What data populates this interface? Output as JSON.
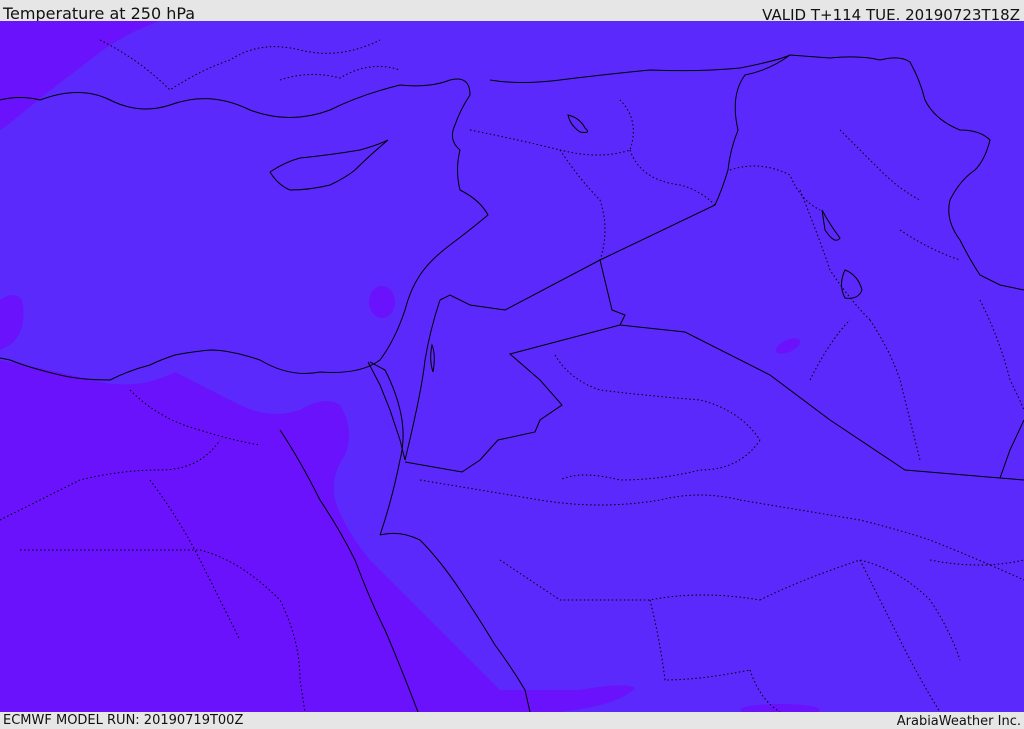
{
  "header": {
    "title": "Temperature at 250 hPa",
    "valid": "VALID T+114 TUE. 20190723T18Z"
  },
  "footer": {
    "model_run": "ECMWF MODEL RUN: 20190719T00Z",
    "credit": "ArabiaWeather Inc."
  },
  "colors": {
    "field_main": "#5b29fb",
    "field_warm": "#6a12fb",
    "border": "#000000",
    "panel": "#e6e6e6"
  },
  "map": {
    "variable": "temperature",
    "level": "250 hPa",
    "region": "Middle East"
  }
}
